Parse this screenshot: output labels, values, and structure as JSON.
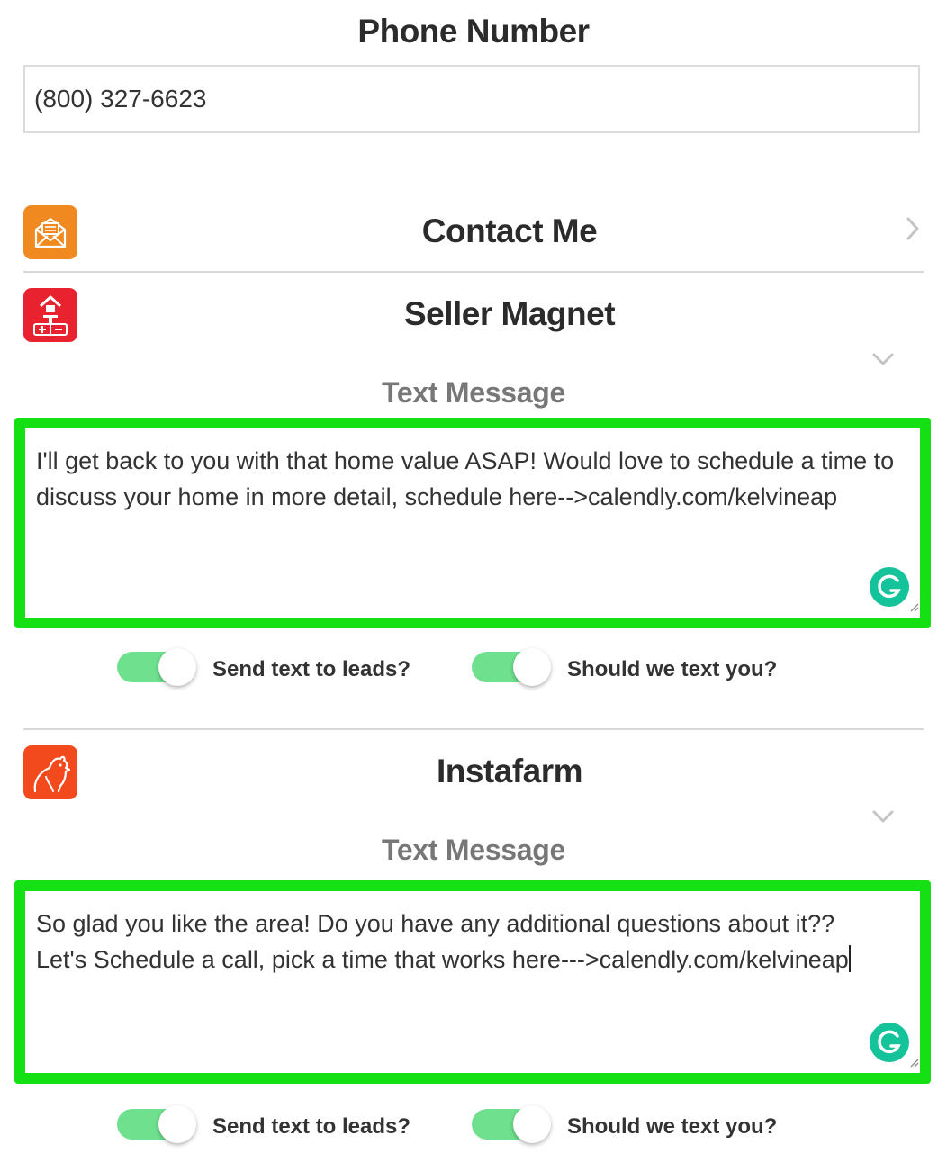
{
  "phone": {
    "heading": "Phone Number",
    "value": "(800) 327-6623"
  },
  "contact_me": {
    "title": "Contact Me",
    "icon": "envelope-icon",
    "icon_color": "#f0891f",
    "chevron": "chevron-right-icon"
  },
  "seller_magnet": {
    "title": "Seller Magnet",
    "icon": "house-sign-icon",
    "icon_color": "#e8232f",
    "chevron": "chevron-down-icon",
    "message_heading": "Text Message",
    "message": "I'll get back to you with that home value ASAP! Would love to schedule a time to discuss your home in more detail, schedule here-->calendly.com/kelvineap",
    "toggle_leads_label": "Send text to leads?",
    "toggle_leads_on": true,
    "toggle_self_label": "Should we text you?",
    "toggle_self_on": true
  },
  "instafarm": {
    "title": "Instafarm",
    "icon": "rooster-icon",
    "icon_color": "#f24a1d",
    "chevron": "chevron-down-icon",
    "message_heading": "Text Message",
    "message_line1": "So glad you like the area! Do you have any additional questions about it??",
    "message_line2": "Let's Schedule a call, pick a time that works here--->calendly.com/kelvineap",
    "toggle_leads_label": "Send text to leads?",
    "toggle_leads_on": true,
    "toggle_self_label": "Should we text you?",
    "toggle_self_on": true
  },
  "colors": {
    "highlight": "#14e014",
    "toggle_on": "#6fe08e",
    "grammarly": "#15c39a"
  }
}
